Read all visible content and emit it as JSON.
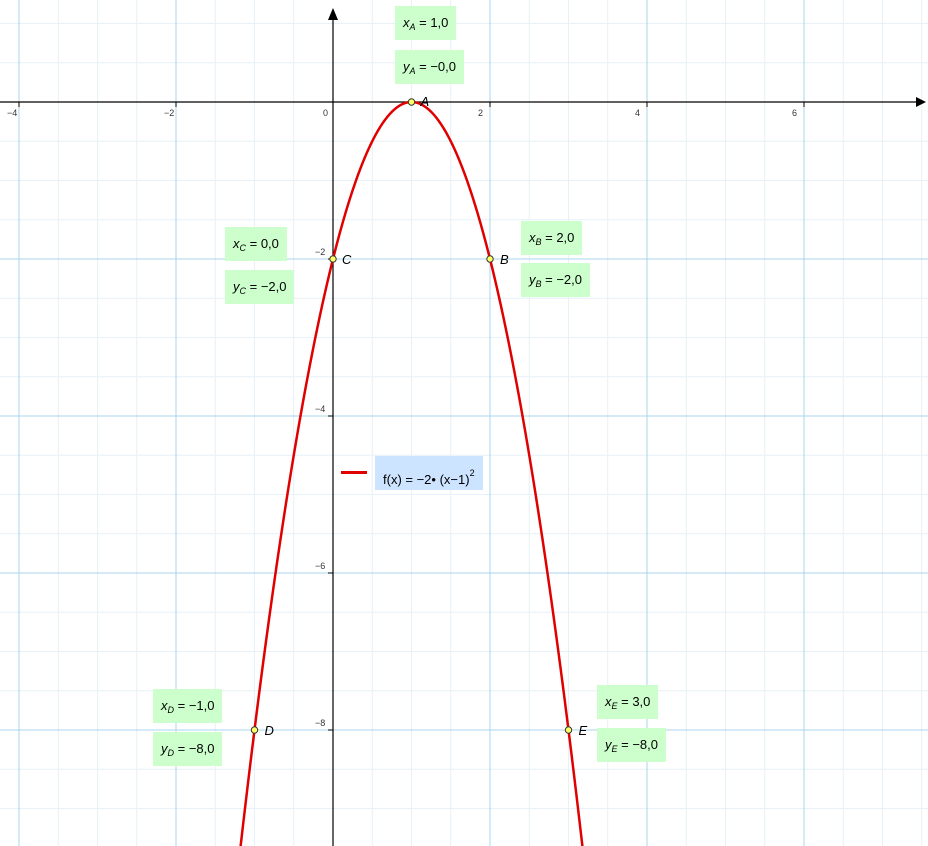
{
  "chart_data": {
    "type": "line",
    "title": "",
    "xlabel": "",
    "ylabel": "",
    "xlim": [
      -4.2,
      7.5
    ],
    "ylim": [
      -9.3,
      1.3
    ],
    "grid": true,
    "x_ticks": [
      "-4",
      "-2",
      "0",
      "2",
      "4",
      "6"
    ],
    "y_ticks": [
      "-2",
      "-4",
      "-6",
      "-8"
    ],
    "series": [
      {
        "name": "f(x) = −2• (x−1)²",
        "expression": "-2*(x-1)^2",
        "a": -2,
        "h": 1,
        "color": "#e00000"
      }
    ],
    "points": [
      {
        "label": "A",
        "x": 1,
        "y": 0
      },
      {
        "label": "B",
        "x": 2,
        "y": -2
      },
      {
        "label": "C",
        "x": 0,
        "y": -2
      },
      {
        "label": "D",
        "x": -1,
        "y": -8
      },
      {
        "label": "E",
        "x": 3,
        "y": -8
      }
    ],
    "point_color": "#ffff66",
    "grid_color": "#a8d4ec",
    "box_color": "#ccffcc",
    "function_box_color": "#cce4ff"
  },
  "boxes": {
    "A": {
      "x_var": "x",
      "x_sub": "A",
      "x_text": " = 1,0",
      "y_var": "y",
      "y_sub": "A",
      "y_text": " = −0,0"
    },
    "B": {
      "x_var": "x",
      "x_sub": "B",
      "x_text": " = 2,0",
      "y_var": "y",
      "y_sub": "B",
      "y_text": " = −2,0"
    },
    "C": {
      "x_var": "x",
      "x_sub": "C",
      "x_text": " = 0,0",
      "y_var": "y",
      "y_sub": "C",
      "y_text": " = −2,0"
    },
    "D": {
      "x_var": "x",
      "x_sub": "D",
      "x_text": " = −1,0",
      "y_var": "y",
      "y_sub": "D",
      "y_text": " = −8,0"
    },
    "E": {
      "x_var": "x",
      "x_sub": "E",
      "x_text": " = 3,0",
      "y_var": "y",
      "y_sub": "E",
      "y_text": " = −8,0"
    }
  },
  "function_label": {
    "text": "f(x) = −2• (x−1)",
    "exponent": "2"
  }
}
